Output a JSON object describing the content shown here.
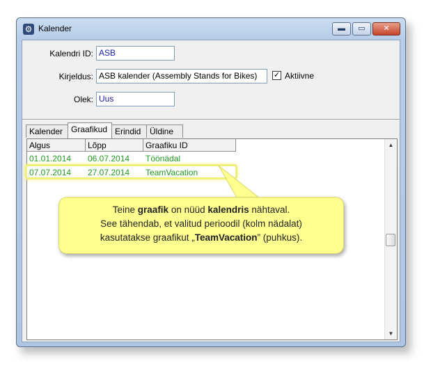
{
  "window": {
    "title": "Kalender",
    "controls": {
      "minimize": "▬",
      "maximize": "▭",
      "close": "✕"
    }
  },
  "form": {
    "id_label": "Kalendri ID:",
    "id_value": "ASB",
    "desc_label": "Kirjeldus:",
    "desc_value": "ASB kalender (Assembly Stands for Bikes)",
    "active_label": "Aktiivne",
    "active_checked": "✓",
    "state_label": "Olek:",
    "state_value": "Uus"
  },
  "tabs": [
    "Kalender",
    "Graafikud",
    "Erindid",
    "Üldine"
  ],
  "grid": {
    "columns": [
      "Algus",
      "Lõpp",
      "Graafiku ID"
    ],
    "rows": [
      [
        "01.01.2014",
        "06.07.2014",
        "Töönädal"
      ],
      [
        "07.07.2014",
        "27.07.2014",
        "TeamVacation"
      ]
    ],
    "row_color": "#1f9a1f"
  },
  "callout": {
    "l1a": "Teine ",
    "l1b": "graafik",
    "l1c": " on nüüd ",
    "l1d": "kalendris",
    "l1e": " nähtaval.",
    "l2": "See tähendab, et  valitud perioodil (kolm nädalat)",
    "l3a": "kasutatakse graafikut „",
    "l3b": "TeamVacation",
    "l3c": "” (puhkus)."
  },
  "colors": {
    "callout_bg": "#ffff90",
    "highlight": "#eef07a",
    "link_text": "#1a1aa8"
  }
}
